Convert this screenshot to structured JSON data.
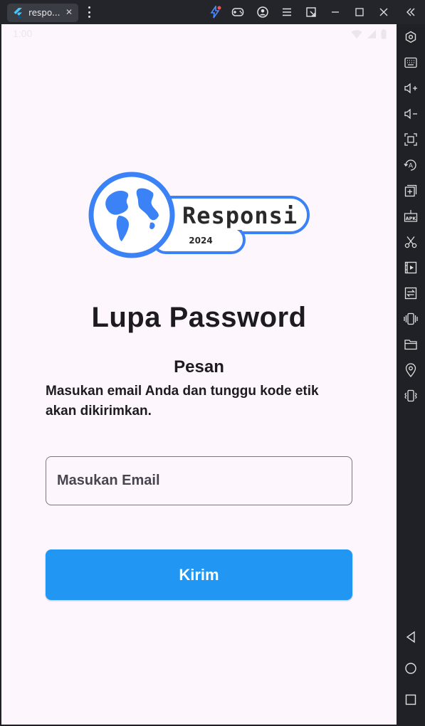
{
  "window": {
    "tab_title": "respo...",
    "close_glyph": "✕"
  },
  "toolbar_icons": [
    "flash-icon",
    "gamepad-icon",
    "account-icon",
    "menu-icon",
    "export-window-icon",
    "minimize-icon",
    "maximize-icon",
    "close-icon",
    "collapse-icon"
  ],
  "sidebar_icons": [
    "settings-icon",
    "keyboard-icon",
    "volume-up-icon",
    "volume-down-icon",
    "screenshot-icon",
    "rotate-icon",
    "add-window-icon",
    "apk-icon",
    "cut-icon",
    "video-icon",
    "transfer-icon",
    "shake-icon",
    "folder-icon",
    "location-icon",
    "vibrate-icon",
    "back-icon",
    "home-icon",
    "recents-icon"
  ],
  "status_bar": {
    "time": "1:00"
  },
  "logo": {
    "brand": "Responsi",
    "year": "2024",
    "accent_color": "#3b82f6"
  },
  "page": {
    "title": "Lupa Password",
    "message_heading": "Pesan",
    "message_body": "Masukan email Anda dan tunggu kode etik akan dikirimkan."
  },
  "email_input": {
    "placeholder": "Masukan Email",
    "value": ""
  },
  "submit_button": {
    "label": "Kirim",
    "color": "#2196f3"
  }
}
